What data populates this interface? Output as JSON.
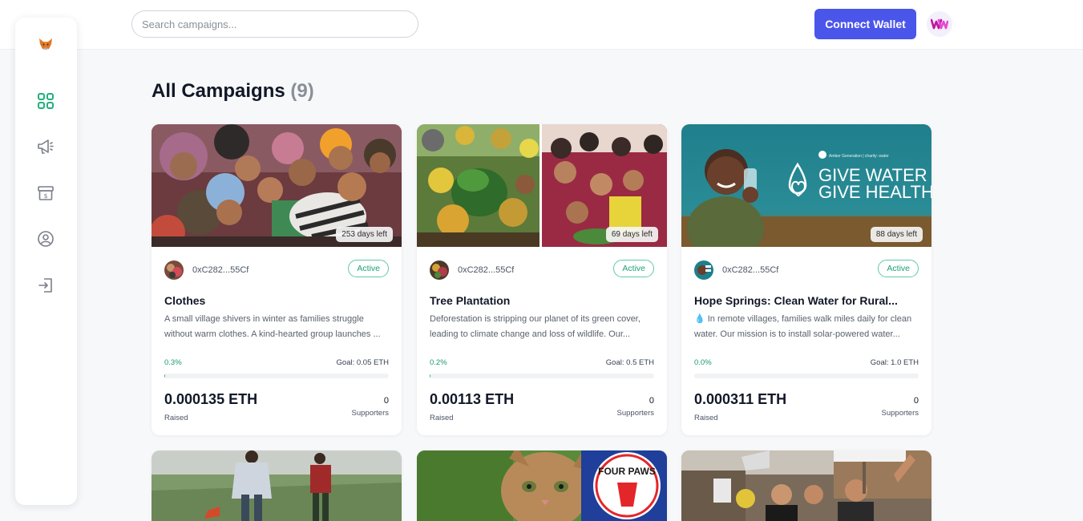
{
  "search": {
    "placeholder": "Search campaigns..."
  },
  "header": {
    "connect_label": "Connect Wallet",
    "brand_icon": "wm-logo-icon"
  },
  "sidebar": {
    "logo_icon": "fox-logo-icon",
    "items": [
      {
        "name": "dashboard",
        "icon": "grid-icon",
        "active": true
      },
      {
        "name": "campaigns",
        "icon": "megaphone-icon",
        "active": false
      },
      {
        "name": "withdraw",
        "icon": "money-box-icon",
        "active": false
      },
      {
        "name": "profile",
        "icon": "user-circle-icon",
        "active": false
      },
      {
        "name": "login",
        "icon": "login-icon",
        "active": false
      }
    ]
  },
  "main": {
    "title": "All Campaigns",
    "count": "(9)"
  },
  "campaigns": [
    {
      "days_left": "253 days left",
      "owner": "0xC282...55Cf",
      "status": "Active",
      "title": "Clothes",
      "description": "A small village shivers in winter as families struggle without warm clothes. A kind-hearted group launches ...",
      "percent": "0.3%",
      "progress": 0.003,
      "goal": "Goal: 0.05 ETH",
      "raised": "0.000135 ETH",
      "raised_label": "Raised",
      "supporters": "0",
      "supporters_label": "Supporters"
    },
    {
      "days_left": "69 days left",
      "owner": "0xC282...55Cf",
      "status": "Active",
      "title": "Tree Plantation",
      "description": "Deforestation is stripping our planet of its green cover, leading to climate change and loss of wildlife. Our...",
      "percent": "0.2%",
      "progress": 0.002,
      "goal": "Goal: 0.5 ETH",
      "raised": "0.00113 ETH",
      "raised_label": "Raised",
      "supporters": "0",
      "supporters_label": "Supporters"
    },
    {
      "days_left": "88 days left",
      "owner": "0xC282...55Cf",
      "status": "Active",
      "title": "Hope Springs: Clean Water for Rural...",
      "description": "💧 In remote villages, families walk miles daily for clean water. Our mission is to install solar-powered water...",
      "percent": "0.0%",
      "progress": 0.0,
      "goal": "Goal: 1.0 ETH",
      "raised": "0.000311 ETH",
      "raised_label": "Raised",
      "supporters": "0",
      "supporters_label": "Supporters",
      "image_text": {
        "line1": "GIVE WATER",
        "line2": "GIVE HEALTH",
        "brand": "Amber Generation | charity: water"
      }
    }
  ],
  "image_text": {
    "four_paws": "FOUR PAWS"
  },
  "colors": {
    "accent": "#4a55ea",
    "active_green": "#1aa374",
    "progress_green": "#22b07d"
  }
}
